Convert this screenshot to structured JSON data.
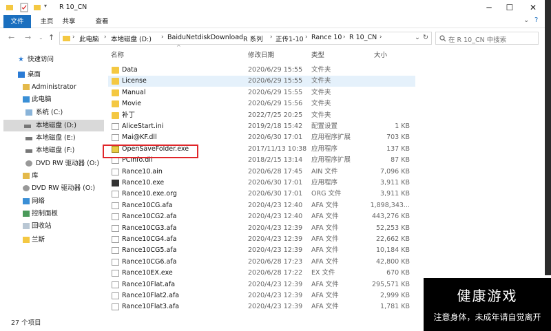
{
  "window": {
    "title": "R 10_CN"
  },
  "ribbon": {
    "tabs": [
      "文件",
      "主页",
      "共享",
      "查看"
    ]
  },
  "address": {
    "crumbs": [
      "此电脑",
      "本地磁盘 (D:)",
      "BaiduNetdiskDownload",
      "R 系列",
      "正传1-10",
      "Rance 10",
      "R 10_CN"
    ],
    "search_placeholder": "在 R 10_CN 中搜索"
  },
  "nav": {
    "items": [
      {
        "label": "快速访问",
        "icon": "star-icon"
      },
      {
        "label": "桌面",
        "icon": "desktop-icon"
      },
      {
        "label": "Administrator",
        "icon": "user-icon"
      },
      {
        "label": "此电脑",
        "icon": "pc-icon"
      },
      {
        "label": "系统 (C:)",
        "icon": "drive-icon"
      },
      {
        "label": "本地磁盘 (D:)",
        "icon": "drive-icon"
      },
      {
        "label": "本地磁盘 (E:)",
        "icon": "drive-icon"
      },
      {
        "label": "本地磁盘 (F:)",
        "icon": "drive-icon"
      },
      {
        "label": "DVD RW 驱动器 (O:)",
        "icon": "dvd-icon"
      },
      {
        "label": "库",
        "icon": "library-icon"
      },
      {
        "label": "DVD RW 驱动器 (O:)",
        "icon": "dvd-icon"
      },
      {
        "label": "网络",
        "icon": "network-icon"
      },
      {
        "label": "控制面板",
        "icon": "control-panel-icon"
      },
      {
        "label": "回收站",
        "icon": "recycle-bin-icon"
      },
      {
        "label": "兰斯",
        "icon": "folder-icon"
      }
    ]
  },
  "columns": {
    "name": "名称",
    "date": "修改日期",
    "type": "类型",
    "size": "大小"
  },
  "files": [
    {
      "name": "Data",
      "date": "2020/6/29 15:55",
      "type": "文件夹",
      "size": "",
      "icon": "folder"
    },
    {
      "name": "License",
      "date": "2020/6/29 15:55",
      "type": "文件夹",
      "size": "",
      "icon": "folder"
    },
    {
      "name": "Manual",
      "date": "2020/6/29 15:55",
      "type": "文件夹",
      "size": "",
      "icon": "folder"
    },
    {
      "name": "Movie",
      "date": "2020/6/29 15:56",
      "type": "文件夹",
      "size": "",
      "icon": "folder"
    },
    {
      "name": "补丁",
      "date": "2022/7/25 20:25",
      "type": "文件夹",
      "size": "",
      "icon": "folder"
    },
    {
      "name": "AliceStart.ini",
      "date": "2019/2/18 15:42",
      "type": "配置设置",
      "size": "1 KB",
      "icon": "doc"
    },
    {
      "name": "Mai@KF.dll",
      "date": "2020/6/30 17:01",
      "type": "应用程序扩展",
      "size": "703 KB",
      "icon": "doc"
    },
    {
      "name": "OpenSaveFolder.exe",
      "date": "2017/11/13 10:38",
      "type": "应用程序",
      "size": "137 KB",
      "icon": "exe-y"
    },
    {
      "name": "PCInfo.dll",
      "date": "2018/2/15 13:14",
      "type": "应用程序扩展",
      "size": "87 KB",
      "icon": "doc"
    },
    {
      "name": "Rance10.ain",
      "date": "2020/6/28 17:45",
      "type": "AIN 文件",
      "size": "7,096 KB",
      "icon": "doc"
    },
    {
      "name": "Rance10.exe",
      "date": "2020/6/30 17:01",
      "type": "应用程序",
      "size": "3,911 KB",
      "icon": "exe"
    },
    {
      "name": "Rance10.exe.org",
      "date": "2020/6/30 17:01",
      "type": "ORG 文件",
      "size": "3,911 KB",
      "icon": "doc"
    },
    {
      "name": "Rance10CG.afa",
      "date": "2020/4/23 12:40",
      "type": "AFA 文件",
      "size": "1,898,343...",
      "icon": "doc"
    },
    {
      "name": "Rance10CG2.afa",
      "date": "2020/4/23 12:40",
      "type": "AFA 文件",
      "size": "443,276 KB",
      "icon": "doc"
    },
    {
      "name": "Rance10CG3.afa",
      "date": "2020/4/23 12:39",
      "type": "AFA 文件",
      "size": "52,253 KB",
      "icon": "doc"
    },
    {
      "name": "Rance10CG4.afa",
      "date": "2020/4/23 12:39",
      "type": "AFA 文件",
      "size": "22,662 KB",
      "icon": "doc"
    },
    {
      "name": "Rance10CG5.afa",
      "date": "2020/4/23 12:39",
      "type": "AFA 文件",
      "size": "10,184 KB",
      "icon": "doc"
    },
    {
      "name": "Rance10CG6.afa",
      "date": "2020/6/28 17:23",
      "type": "AFA 文件",
      "size": "42,800 KB",
      "icon": "doc"
    },
    {
      "name": "Rance10EX.exe",
      "date": "2020/6/28 17:22",
      "type": "EX 文件",
      "size": "670 KB",
      "icon": "doc"
    },
    {
      "name": "Rance10Flat.afa",
      "date": "2020/4/23 12:39",
      "type": "AFA 文件",
      "size": "295,571 KB",
      "icon": "doc"
    },
    {
      "name": "Rance10Flat2.afa",
      "date": "2020/4/23 12:39",
      "type": "AFA 文件",
      "size": "2,999 KB",
      "icon": "doc"
    },
    {
      "name": "Rance10Flat3.afa",
      "date": "2020/4/23 12:39",
      "type": "AFA 文件",
      "size": "1,781 KB",
      "icon": "doc"
    }
  ],
  "status": {
    "count": "27 个项目"
  },
  "overlay": {
    "title": "健康游戏",
    "subtitle": "注意身体，未成年请自觉离开"
  },
  "colors": {
    "accent": "#1a6fbf",
    "highlight": "#e5f1fb",
    "redbox": "#e0262a"
  }
}
